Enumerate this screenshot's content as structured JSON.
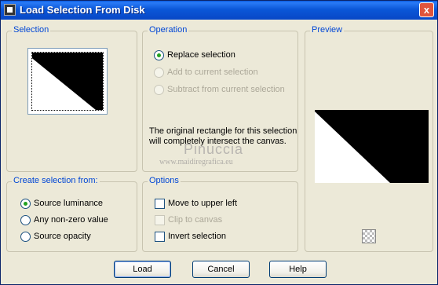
{
  "window": {
    "title": "Load Selection From Disk",
    "close_label": "x"
  },
  "selection": {
    "title": "Selection"
  },
  "operation": {
    "title": "Operation",
    "options": [
      {
        "label": "Replace selection",
        "selected": true,
        "disabled": false
      },
      {
        "label": "Add to current selection",
        "selected": false,
        "disabled": true
      },
      {
        "label": "Subtract from current selection",
        "selected": false,
        "disabled": true
      }
    ],
    "info_line1": "The original rectangle for this selection",
    "info_line2": "will completely intersect the canvas.",
    "watermark_name": "Pinuccia",
    "watermark_url": "www.maidiregrafica.eu"
  },
  "preview": {
    "title": "Preview",
    "icon": "checkerboard-icon"
  },
  "create_from": {
    "title": "Create selection from:",
    "options": [
      {
        "label": "Source luminance",
        "selected": true
      },
      {
        "label": "Any non-zero value",
        "selected": false
      },
      {
        "label": "Source opacity",
        "selected": false
      }
    ]
  },
  "options": {
    "title": "Options",
    "items": [
      {
        "label": "Move to upper left",
        "checked": false,
        "disabled": false
      },
      {
        "label": "Clip to canvas",
        "checked": false,
        "disabled": true
      },
      {
        "label": "Invert selection",
        "checked": false,
        "disabled": false
      }
    ]
  },
  "buttons": {
    "load": "Load",
    "cancel": "Cancel",
    "help": "Help"
  }
}
